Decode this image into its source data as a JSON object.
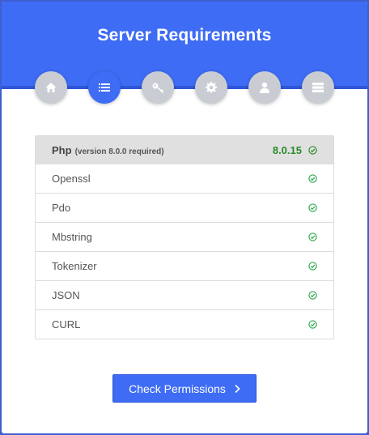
{
  "header": {
    "title": "Server Requirements"
  },
  "steps": [
    {
      "icon": "home-icon",
      "active": false
    },
    {
      "icon": "list-icon",
      "active": true
    },
    {
      "icon": "key-icon",
      "active": false
    },
    {
      "icon": "gear-icon",
      "active": false
    },
    {
      "icon": "user-icon",
      "active": false
    },
    {
      "icon": "server-icon",
      "active": false
    }
  ],
  "php": {
    "label": "Php",
    "requirement": "(version 8.0.0 required)",
    "version": "8.0.15",
    "status": "ok"
  },
  "extensions": [
    {
      "name": "Openssl",
      "status": "ok"
    },
    {
      "name": "Pdo",
      "status": "ok"
    },
    {
      "name": "Mbstring",
      "status": "ok"
    },
    {
      "name": "Tokenizer",
      "status": "ok"
    },
    {
      "name": "JSON",
      "status": "ok"
    },
    {
      "name": "CURL",
      "status": "ok"
    }
  ],
  "actions": {
    "check_permissions_label": "Check Permissions"
  },
  "colors": {
    "accent": "#3e6cf5",
    "success": "#2a8a2a",
    "inactive_step": "#c9cdd3"
  }
}
